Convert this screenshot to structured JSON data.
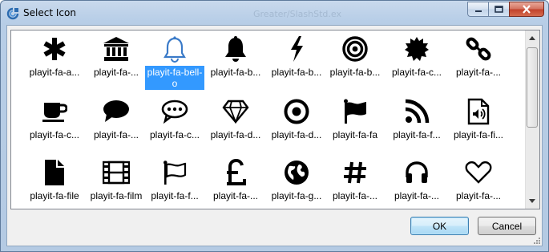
{
  "window": {
    "title": "Select Icon",
    "background_title_ghost": "Greater/SlashStd.ex",
    "caption_buttons": [
      "minimize",
      "maximize",
      "close"
    ]
  },
  "grid": {
    "selected_index": 2,
    "items": [
      {
        "label": "playit-fa-a...",
        "icon": "asterisk-icon"
      },
      {
        "label": "playit-fa-...",
        "icon": "bank-icon"
      },
      {
        "label": "playit-fa-bell-o",
        "icon": "bell-o-icon"
      },
      {
        "label": "playit-fa-b...",
        "icon": "bell-icon"
      },
      {
        "label": "playit-fa-b...",
        "icon": "bolt-icon"
      },
      {
        "label": "playit-fa-b...",
        "icon": "bullseye-icon"
      },
      {
        "label": "playit-fa-c...",
        "icon": "certificate-icon"
      },
      {
        "label": "playit-fa-...",
        "icon": "chain-icon"
      },
      {
        "label": "playit-fa-c...",
        "icon": "coffee-icon"
      },
      {
        "label": "playit-fa-...",
        "icon": "comment-icon"
      },
      {
        "label": "playit-fa-c...",
        "icon": "commenting-o-icon"
      },
      {
        "label": "playit-fa-d...",
        "icon": "diamond-icon"
      },
      {
        "label": "playit-fa-d...",
        "icon": "dot-circle-icon"
      },
      {
        "label": "playit-fa-fa",
        "icon": "flag-icon"
      },
      {
        "label": "playit-fa-f...",
        "icon": "feed-icon"
      },
      {
        "label": "playit-fa-fi...",
        "icon": "file-audio-icon"
      },
      {
        "label": "playit-fa-file",
        "icon": "file-icon"
      },
      {
        "label": "playit-fa-film",
        "icon": "film-icon"
      },
      {
        "label": "playit-fa-f...",
        "icon": "flag-o-icon"
      },
      {
        "label": "playit-fa-...",
        "icon": "gbp-icon"
      },
      {
        "label": "playit-fa-g...",
        "icon": "globe-icon"
      },
      {
        "label": "playit-fa-...",
        "icon": "hashtag-icon"
      },
      {
        "label": "playit-fa-...",
        "icon": "headphones-icon"
      },
      {
        "label": "playit-fa-...",
        "icon": "heart-o-icon"
      }
    ]
  },
  "buttons": {
    "ok": "OK",
    "cancel": "Cancel"
  },
  "colors": {
    "selection": "#3399ff",
    "titlebar": "#b9cfe8",
    "close_button": "#c1412b"
  }
}
